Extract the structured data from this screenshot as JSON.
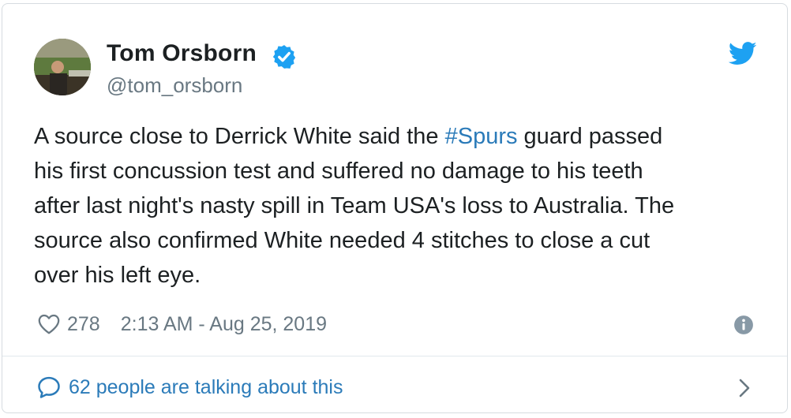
{
  "author": {
    "name": "Tom Orsborn",
    "handle": "@tom_orsborn",
    "verified": true
  },
  "tweet": {
    "lines": [
      {
        "before": "A source close to Derrick White said the ",
        "hashtag": "#Spurs",
        "after": " guard passed"
      },
      {
        "text": "his first concussion test and suffered no damage to his teeth"
      },
      {
        "text": "after last night's nasty spill in Team USA's loss to Australia. The"
      },
      {
        "text": "source also confirmed White needed 4 stitches to close a cut"
      },
      {
        "text": "over his left eye."
      }
    ]
  },
  "meta": {
    "likes": "278",
    "timestamp": "2:13 AM - Aug 25, 2019"
  },
  "footer": {
    "talking_label": "62 people are talking about this"
  },
  "colors": {
    "link": "#2b7bb9",
    "secondary": "#697882",
    "verified": "#1da1f2",
    "twitter_blue": "#1da1f2"
  },
  "icons": [
    "verified-badge-icon",
    "twitter-bird-icon",
    "heart-icon",
    "info-icon",
    "speech-bubble-icon",
    "chevron-right-icon"
  ]
}
